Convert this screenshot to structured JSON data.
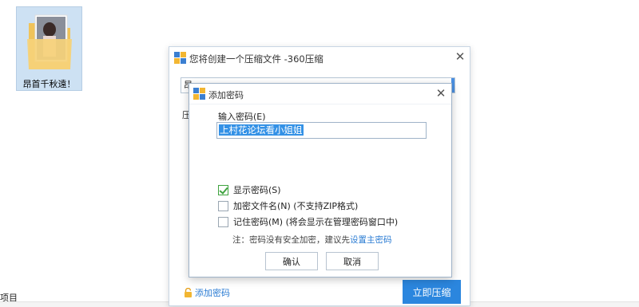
{
  "desktop": {
    "folder_label": "昂首千秋遠！",
    "bottom_left_text": "项目"
  },
  "outer_dialog": {
    "title": "您将创建一个压缩文件 -360压缩",
    "path_prefix": "昂",
    "side_label": "压",
    "add_password_link": "添加密码",
    "compress_button": "立即压缩"
  },
  "inner_dialog": {
    "title": "添加密码",
    "password_label": "输入密码(E)",
    "password_value": "上村花论坛看小姐姐",
    "options": [
      {
        "label": "显示密码(S)",
        "checked": true
      },
      {
        "label": "加密文件名(N) (不支持ZIP格式)",
        "checked": false
      },
      {
        "label": "记住密码(M) (将会显示在管理密码窗口中)",
        "checked": false
      }
    ],
    "note_text": "注：密码没有安全加密，建议先",
    "note_link": "设置主密码",
    "ok_button": "确认",
    "cancel_button": "取消"
  },
  "colors": {
    "accent": "#2b86de",
    "link": "#2b7cd3",
    "check": "#3fa33f",
    "selection": "#3391e6"
  }
}
